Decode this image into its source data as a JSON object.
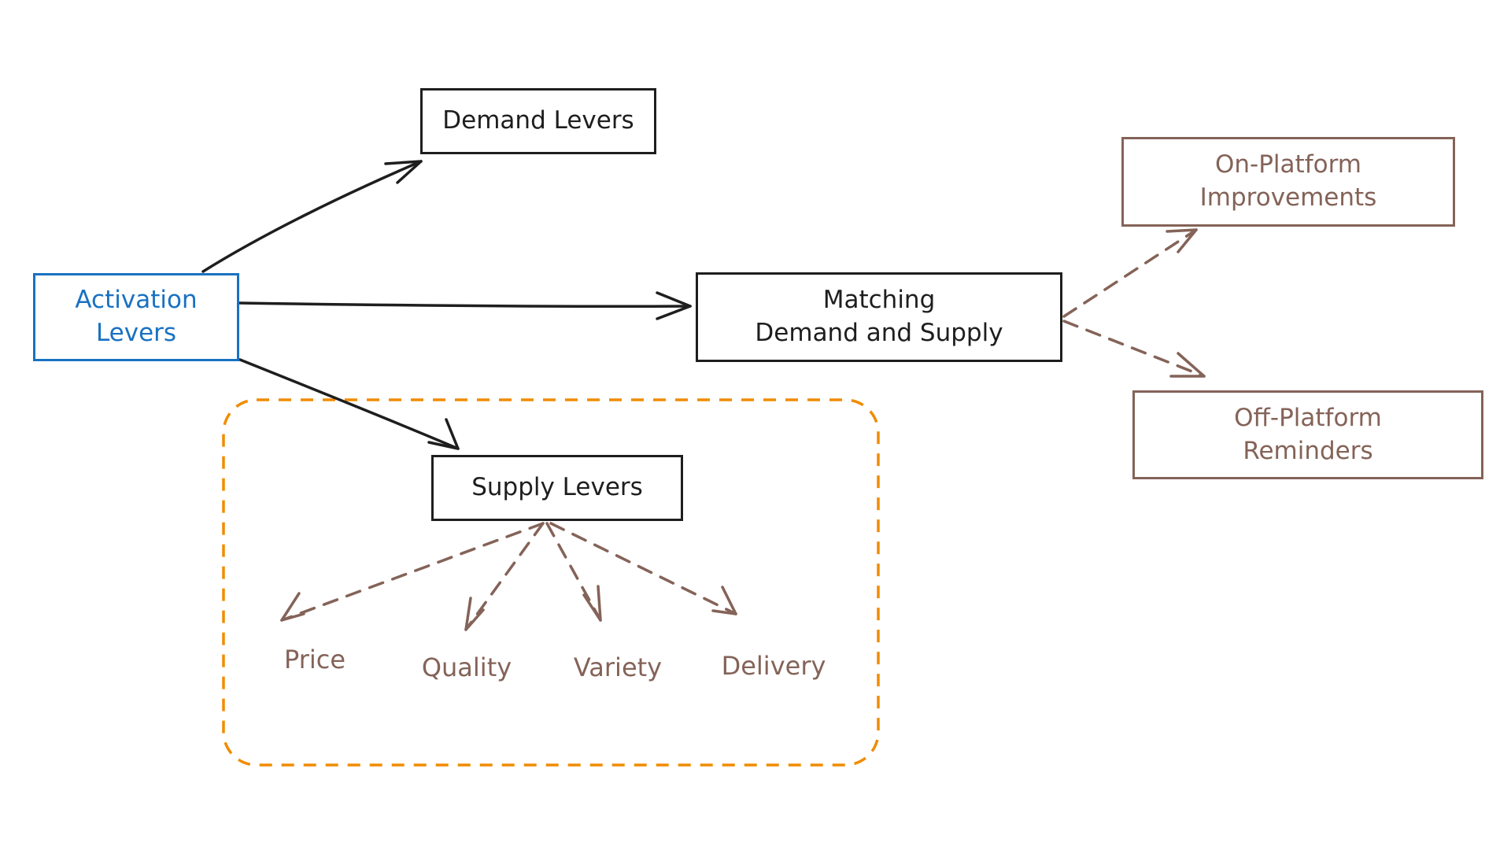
{
  "colors": {
    "activation": "#1971c2",
    "primary": "#1e1e1e",
    "secondary": "#846358",
    "group_border": "#f08c00",
    "background": "#ffffff"
  },
  "nodes": {
    "activation": {
      "line1": "Activation",
      "line2": "Levers"
    },
    "demand": {
      "line1": "Demand Levers"
    },
    "matching": {
      "line1": "Matching",
      "line2": "Demand and Supply"
    },
    "supply": {
      "line1": "Supply Levers"
    },
    "on_platform": {
      "line1": "On-Platform",
      "line2": "Improvements"
    },
    "off_platform": {
      "line1": "Off-Platform",
      "line2": "Reminders"
    }
  },
  "supply_factors": [
    "Price",
    "Quality",
    "Variety",
    "Delivery"
  ],
  "edges": [
    {
      "from": "Activation Levers",
      "to": "Demand Levers",
      "style": "solid"
    },
    {
      "from": "Activation Levers",
      "to": "Matching Demand and Supply",
      "style": "solid"
    },
    {
      "from": "Activation Levers",
      "to": "Supply Levers",
      "style": "solid"
    },
    {
      "from": "Matching Demand and Supply",
      "to": "On-Platform Improvements",
      "style": "dashed"
    },
    {
      "from": "Matching Demand and Supply",
      "to": "Off-Platform Reminders",
      "style": "dashed"
    },
    {
      "from": "Supply Levers",
      "to": "Price",
      "style": "dashed"
    },
    {
      "from": "Supply Levers",
      "to": "Quality",
      "style": "dashed"
    },
    {
      "from": "Supply Levers",
      "to": "Variety",
      "style": "dashed"
    },
    {
      "from": "Supply Levers",
      "to": "Delivery",
      "style": "dashed"
    }
  ]
}
